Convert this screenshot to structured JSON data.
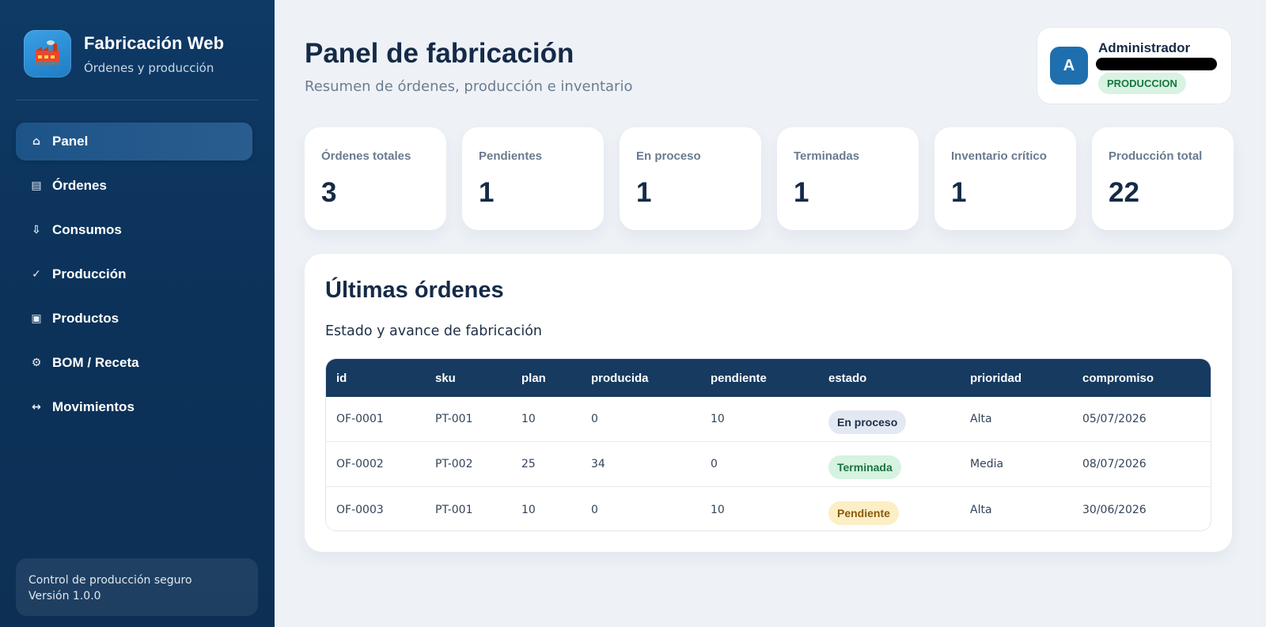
{
  "brand": {
    "title": "Fabricación Web",
    "subtitle": "Órdenes y producción",
    "logo_icon": "factory-icon"
  },
  "sidebar": {
    "items": [
      {
        "label": "Panel",
        "icon": "⌂",
        "active": true
      },
      {
        "label": "Órdenes",
        "icon": "▤",
        "active": false
      },
      {
        "label": "Consumos",
        "icon": "⇩",
        "active": false
      },
      {
        "label": "Producción",
        "icon": "✓",
        "active": false
      },
      {
        "label": "Productos",
        "icon": "▣",
        "active": false
      },
      {
        "label": "BOM / Receta",
        "icon": "⚙",
        "active": false
      },
      {
        "label": "Movimientos",
        "icon": "↔",
        "active": false
      }
    ],
    "footer": {
      "line1": "Control de producción seguro",
      "line2": "Versión 1.0.0"
    }
  },
  "header": {
    "title": "Panel de fabricación",
    "subtitle": "Resumen de órdenes, producción e inventario"
  },
  "user": {
    "initial": "A",
    "name": "Administrador",
    "role": "PRODUCCION"
  },
  "stats": [
    {
      "label": "Órdenes totales",
      "value": "3"
    },
    {
      "label": "Pendientes",
      "value": "1"
    },
    {
      "label": "En proceso",
      "value": "1"
    },
    {
      "label": "Terminadas",
      "value": "1"
    },
    {
      "label": "Inventario crítico",
      "value": "1"
    },
    {
      "label": "Producción total",
      "value": "22"
    }
  ],
  "orders": {
    "title": "Últimas órdenes",
    "subtitle": "Estado y avance de fabricación",
    "columns": [
      "id",
      "sku",
      "plan",
      "producida",
      "pendiente",
      "estado",
      "prioridad",
      "compromiso"
    ],
    "rows": [
      {
        "id": "OF-0001",
        "sku": "PT-001",
        "plan": "10",
        "producida": "0",
        "pendiente": "10",
        "estado": "En proceso",
        "prioridad": "Alta",
        "compromiso": "05/07/2026"
      },
      {
        "id": "OF-0002",
        "sku": "PT-002",
        "plan": "25",
        "producida": "34",
        "pendiente": "0",
        "estado": "Terminada",
        "prioridad": "Media",
        "compromiso": "08/07/2026"
      },
      {
        "id": "OF-0003",
        "sku": "PT-001",
        "plan": "10",
        "producida": "0",
        "pendiente": "10",
        "estado": "Pendiente",
        "prioridad": "Alta",
        "compromiso": "30/06/2026"
      }
    ]
  },
  "colors": {
    "sidebar_bg": "#0f3a66",
    "main_bg": "#eef2f7",
    "table_header": "#163a60",
    "text_dark": "#152a47",
    "badge_proceso": "#e3e9f2",
    "badge_terminada": "#d6f2e0",
    "badge_pendiente": "#fcefc5"
  }
}
